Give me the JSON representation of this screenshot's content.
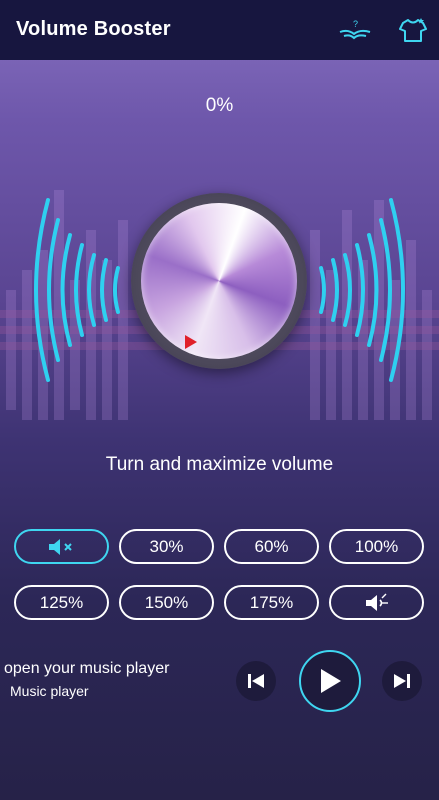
{
  "header": {
    "title": "Volume Booster",
    "help_icon": "help-lamp-icon",
    "theme_icon": "tshirt-icon",
    "background": "#17163f"
  },
  "booster": {
    "level_text": "0%",
    "level_fraction": 0.0,
    "instruction": "Turn and maximize volume"
  },
  "presets": {
    "items": [
      {
        "label": "",
        "icon": "mute-icon",
        "active": true
      },
      {
        "label": "30%"
      },
      {
        "label": "60%"
      },
      {
        "label": "100%"
      },
      {
        "label": "125%"
      },
      {
        "label": "150%"
      },
      {
        "label": "175%"
      },
      {
        "label": "",
        "icon": "volume-max-icon"
      }
    ]
  },
  "player": {
    "line1": "open your music player",
    "line2": "Music player",
    "prev_icon": "skip-previous-icon",
    "play_icon": "play-icon",
    "next_icon": "skip-next-icon"
  },
  "colors": {
    "accent": "#3fd6f0",
    "marker": "#e0202a",
    "header": "#17163f"
  }
}
